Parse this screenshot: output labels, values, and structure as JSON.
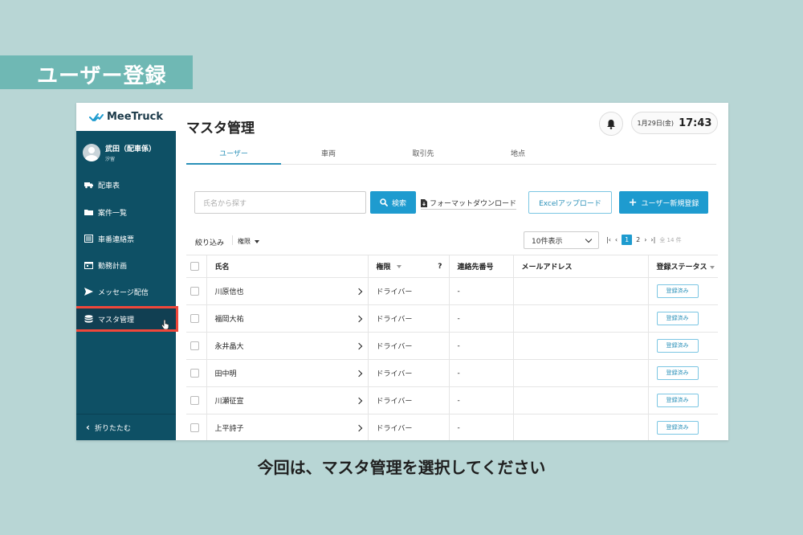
{
  "banner": {
    "title": "ユーザー登録"
  },
  "app": {
    "logo": "MeeTruck",
    "user": {
      "name": "武田（配車係）",
      "sub": "汐留"
    },
    "nav": [
      {
        "label": "配車表",
        "icon": "truck-icon"
      },
      {
        "label": "案件一覧",
        "icon": "folder-icon"
      },
      {
        "label": "車番連絡票",
        "icon": "list-icon"
      },
      {
        "label": "勤務計画",
        "icon": "calendar-icon"
      },
      {
        "label": "メッセージ配信",
        "icon": "send-icon"
      },
      {
        "label": "マスタ管理",
        "icon": "database-icon",
        "active": true
      }
    ],
    "collapse_label": "折りたたむ",
    "page_title": "マスタ管理",
    "date": "1月29日(金)",
    "time": "17:43",
    "tabs": [
      "ユーザー",
      "車両",
      "取引先",
      "地点"
    ],
    "search": {
      "placeholder": "氏名から探す",
      "button": "検索"
    },
    "format_download": "フォーマットダウンロード",
    "excel_upload": "Excelアップロード",
    "add_user": "ユーザー新規登録",
    "filter": {
      "label": "絞り込み",
      "select": "権限"
    },
    "per_page": "10件表示",
    "pager": {
      "current": "1",
      "next": "2",
      "total": "全 14 件"
    },
    "table": {
      "headers": {
        "name": "氏名",
        "role": "権限",
        "help": "?",
        "tel": "連絡先番号",
        "mail": "メールアドレス",
        "status": "登録ステータス"
      },
      "rows": [
        {
          "name": "川原信也",
          "role": "ドライバー",
          "tel": "-",
          "status": "登録済み"
        },
        {
          "name": "福岡大祐",
          "role": "ドライバー",
          "tel": "-",
          "status": "登録済み"
        },
        {
          "name": "永井晶大",
          "role": "ドライバー",
          "tel": "-",
          "status": "登録済み"
        },
        {
          "name": "田中明",
          "role": "ドライバー",
          "tel": "-",
          "status": "登録済み"
        },
        {
          "name": "川瀬征宣",
          "role": "ドライバー",
          "tel": "-",
          "status": "登録済み"
        },
        {
          "name": "上平詩子",
          "role": "ドライバー",
          "tel": "-",
          "status": "登録済み"
        }
      ]
    }
  },
  "caption": "今回は、マスタ管理を選択してください",
  "colors": {
    "sidebar": "#0e5065",
    "accent": "#1e9bcf",
    "highlight": "#f0473a",
    "banner": "#6fb8b4",
    "background": "#b8d6d5"
  }
}
